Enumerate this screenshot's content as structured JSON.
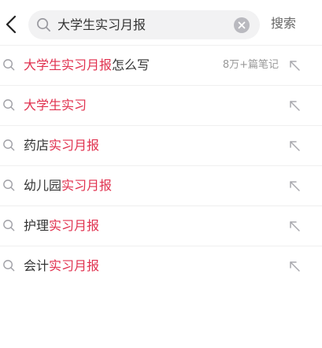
{
  "header": {
    "back_icon": "chevron-left-icon",
    "query": "大学生实习月报",
    "search_label": "搜索",
    "clear_icon": "close-circle-icon"
  },
  "suggestions": [
    {
      "highlight": "大学生实习月报",
      "suffix": "怎么写",
      "prefix": "",
      "count": "8万+篇笔记"
    },
    {
      "highlight": "大学生实习",
      "suffix": "",
      "prefix": "",
      "count": ""
    },
    {
      "prefix": "药店",
      "highlight": "实习月报",
      "suffix": "",
      "count": ""
    },
    {
      "prefix": "幼儿园",
      "highlight": "实习月报",
      "suffix": "",
      "count": ""
    },
    {
      "prefix": "护理",
      "highlight": "实习月报",
      "suffix": "",
      "count": ""
    },
    {
      "prefix": "会计",
      "highlight": "实习月报",
      "suffix": "",
      "count": ""
    }
  ],
  "colors": {
    "highlight": "#e0304e",
    "text": "#333333",
    "muted": "#999999",
    "search_bg": "#f2f2f3"
  }
}
